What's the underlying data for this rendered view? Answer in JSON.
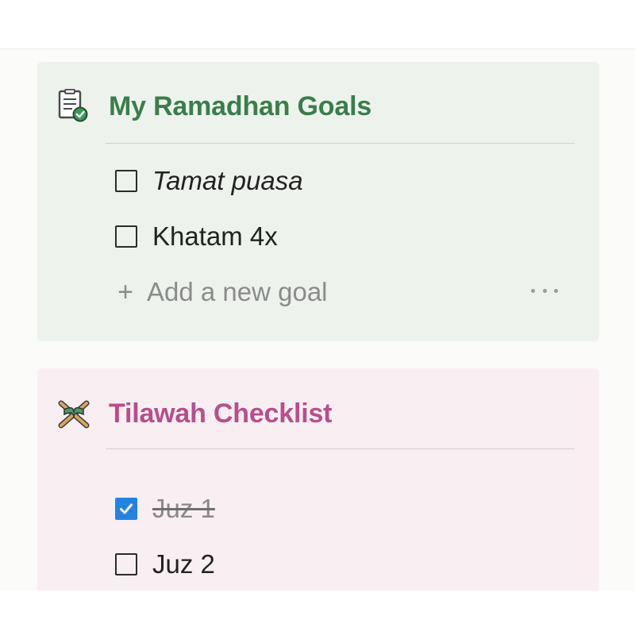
{
  "colors": {
    "goals_card_bg": "#edf3ec",
    "goals_title": "#3a7d4c",
    "tilawah_card_bg": "#f9eff3",
    "tilawah_title": "#b94d8a",
    "checkbox_checked": "#2383e2"
  },
  "goals_card": {
    "title": "My Ramadhan Goals",
    "icon": "checklist-document-icon",
    "items": [
      {
        "label": "Tamat puasa",
        "checked": false,
        "italic": true
      },
      {
        "label": "Khatam 4x",
        "checked": false,
        "italic": false
      }
    ],
    "add_label": "Add a new goal",
    "add_icon": "plus-icon",
    "more_icon": "more-options-icon"
  },
  "tilawah_card": {
    "title": "Tilawah Checklist",
    "icon": "quran-stand-icon",
    "items": [
      {
        "label": "Juz 1",
        "checked": true
      },
      {
        "label": "Juz 2",
        "checked": false
      }
    ]
  }
}
